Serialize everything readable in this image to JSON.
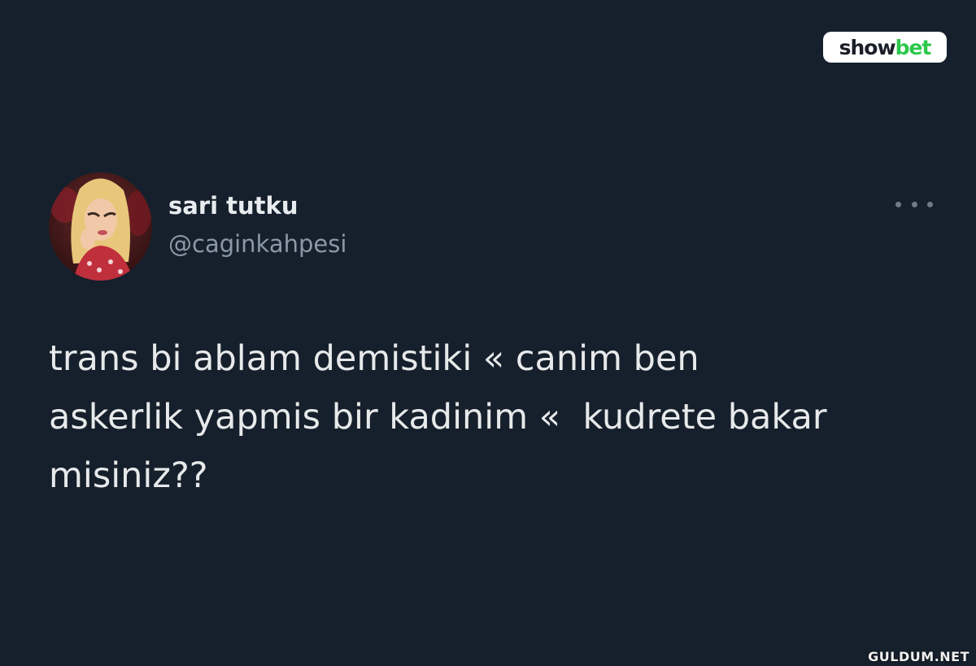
{
  "brand": {
    "logo_part1": "show",
    "logo_part2": "bet",
    "logo_color_dark": "#1b1f2a",
    "logo_color_green": "#2cc84b"
  },
  "tweet": {
    "author": {
      "display_name": "sari tutku",
      "handle": "@caginkahpesi",
      "avatar_icon": "profile-photo"
    },
    "more_icon": "more-horizontal-icon",
    "text_lines": [
      "trans bi ablam demistiki « canim ben",
      "askerlik yapmis bir kadinim «  kudrete bakar",
      "misiniz??"
    ]
  },
  "watermark": "GULDUM.NET",
  "colors": {
    "background": "#16202c",
    "primary_text": "#e7e9ea",
    "secondary_text": "#8b98a5"
  }
}
